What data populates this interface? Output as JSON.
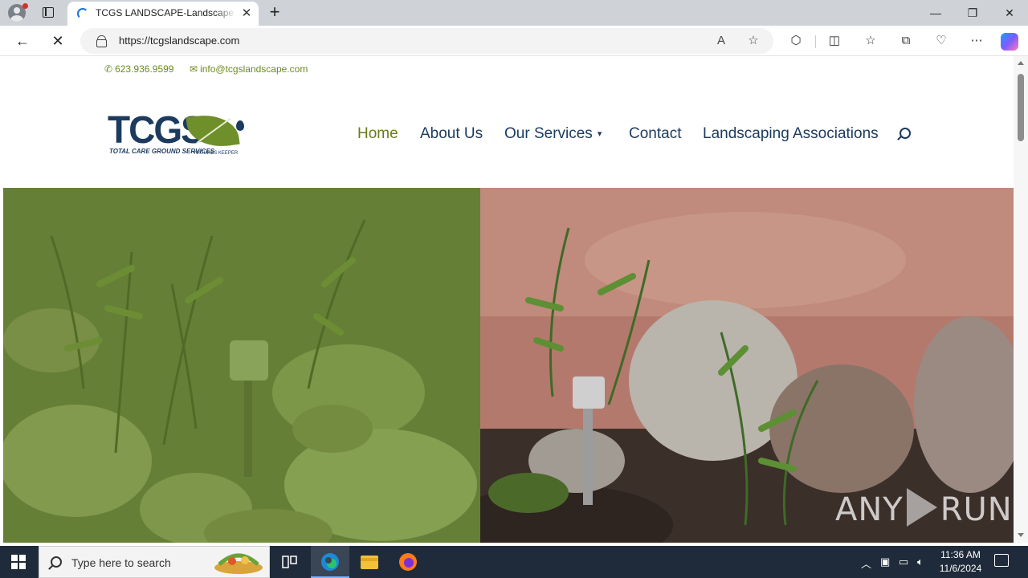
{
  "browser": {
    "tab_title": "TCGS LANDSCAPE-Landscape Maintenance",
    "url": "https://tcgslandscape.com",
    "new_tab_symbol": "+",
    "icons": [
      "profile-icon",
      "tab-actions-icon",
      "loading-spinner-icon",
      "close-icon",
      "back-icon",
      "stop-loading-icon",
      "lock-icon",
      "read-aloud-icon",
      "favorite-star-icon",
      "extensions-icon",
      "split-screen-icon",
      "favorites-icon",
      "collections-icon",
      "browser-essentials-icon",
      "more-icon",
      "copilot-icon"
    ]
  },
  "site": {
    "phone": "623.936.9599",
    "email": "info@tcgslandscape.com",
    "logo": {
      "wordmark": "TCGS",
      "tagline": "TOTAL CARE GROUND SERVICES",
      "subtag": "NATURES KEEPER"
    },
    "nav": [
      {
        "label": "Home",
        "active": true
      },
      {
        "label": "About Us",
        "active": false
      },
      {
        "label": "Our Services",
        "active": false,
        "has_dropdown": true
      },
      {
        "label": "Contact",
        "active": false
      },
      {
        "label": "Landscaping Associations",
        "active": false
      }
    ],
    "colors": {
      "nav_text": "#1c3b5e",
      "nav_active": "#6b7a1a",
      "topbar_text": "#6b8a1a",
      "hero_overlay": "#7a9a2e"
    }
  },
  "watermark": {
    "left": "ANY",
    "right": "RUN"
  },
  "taskbar": {
    "search_placeholder": "Type here to search",
    "time": "11:36 AM",
    "date": "11/6/2024",
    "apps": [
      "task-view-icon",
      "edge-icon",
      "file-explorer-icon",
      "firefox-icon"
    ]
  }
}
